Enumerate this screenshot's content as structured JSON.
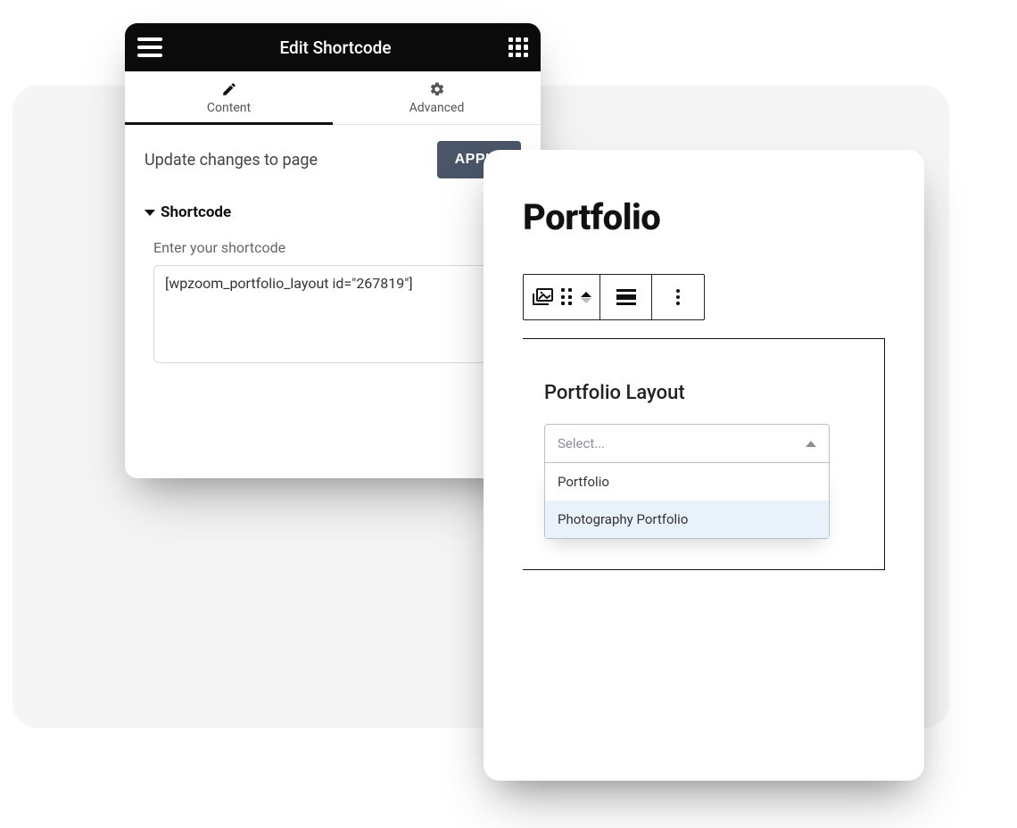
{
  "elementor": {
    "title": "Edit Shortcode",
    "tabs": {
      "content": "Content",
      "advanced": "Advanced"
    },
    "update_label": "Update changes to page",
    "apply_label": "APPLY",
    "section_title": "Shortcode",
    "field_label": "Enter your shortcode",
    "shortcode_value": "[wpzoom_portfolio_layout id=\"267819\"]"
  },
  "gutenberg": {
    "title": "Portfolio",
    "layout_label": "Portfolio Layout",
    "select_placeholder": "Select...",
    "options": [
      "Portfolio",
      "Photography Portfolio"
    ],
    "highlighted_index": 1
  }
}
